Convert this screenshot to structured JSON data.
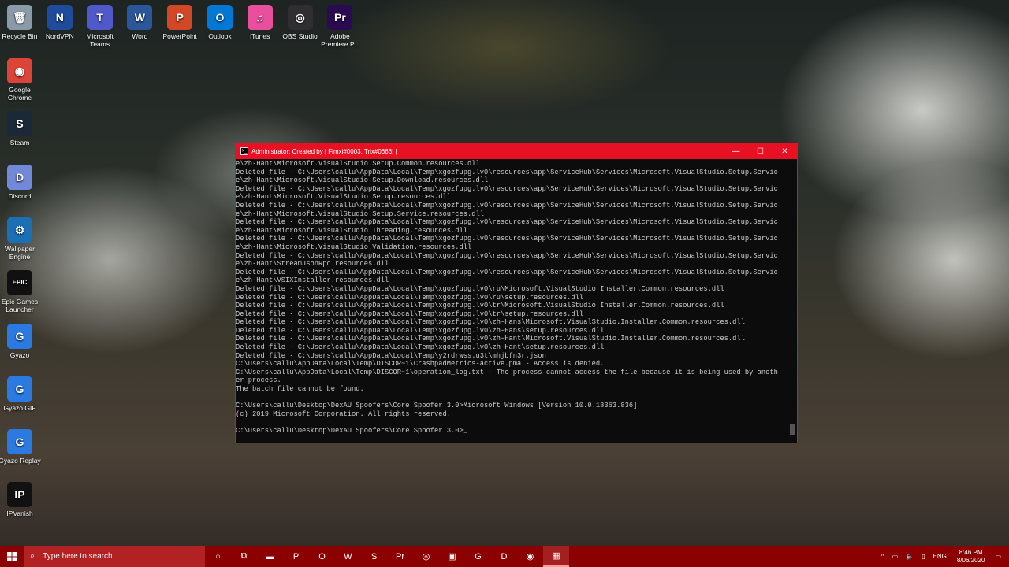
{
  "desktop": {
    "icons": [
      {
        "label": "Recycle Bin",
        "icon": "recycle-bin-icon",
        "color": "#8a9aa8",
        "glyph": "🗑"
      },
      {
        "label": "NordVPN",
        "icon": "nordvpn-icon",
        "color": "#1f4b9c",
        "glyph": "N"
      },
      {
        "label": "Microsoft\nTeams",
        "icon": "teams-icon",
        "color": "#5059c9",
        "glyph": "T"
      },
      {
        "label": "Word",
        "icon": "word-icon",
        "color": "#2b579a",
        "glyph": "W"
      },
      {
        "label": "PowerPoint",
        "icon": "powerpoint-icon",
        "color": "#d24726",
        "glyph": "P"
      },
      {
        "label": "Outlook",
        "icon": "outlook-icon",
        "color": "#0078d4",
        "glyph": "O"
      },
      {
        "label": "iTunes",
        "icon": "itunes-icon",
        "color": "#e94f9c",
        "glyph": "♫"
      },
      {
        "label": "OBS Studio",
        "icon": "obs-icon",
        "color": "#302e31",
        "glyph": "◎"
      },
      {
        "label": "Adobe\nPremiere P...",
        "icon": "premiere-icon",
        "color": "#2a0a50",
        "glyph": "Pr"
      },
      {
        "label": "Google\nChrome",
        "icon": "chrome-icon",
        "color": "#db4437",
        "glyph": "◉"
      },
      {
        "label": "Steam",
        "icon": "steam-icon",
        "color": "#1b2838",
        "glyph": "S"
      },
      {
        "label": "Discord",
        "icon": "discord-icon",
        "color": "#7289da",
        "glyph": "D"
      },
      {
        "label": "Wallpaper\nEngine",
        "icon": "wallpaper-engine-icon",
        "color": "#1a6fb5",
        "glyph": "⚙"
      },
      {
        "label": "Epic Games\nLauncher",
        "icon": "epic-games-icon",
        "color": "#111111",
        "glyph": "EPIC"
      },
      {
        "label": "Gyazo",
        "icon": "gyazo-icon",
        "color": "#2a7ae2",
        "glyph": "G"
      },
      {
        "label": "Gyazo GIF",
        "icon": "gyazo-gif-icon",
        "color": "#2a7ae2",
        "glyph": "G"
      },
      {
        "label": "Gyazo Replay",
        "icon": "gyazo-replay-icon",
        "color": "#2a7ae2",
        "glyph": "G"
      },
      {
        "label": "IPVanish",
        "icon": "ipvanish-icon",
        "color": "#111111",
        "glyph": "IP"
      }
    ]
  },
  "window": {
    "title": "Administrator: Created by | Fimxi#0003, Trix#0666! |",
    "minimize": "—",
    "maximize": "☐",
    "close": "✕",
    "accent": "#e81123",
    "console_lines": [
      "e\\zh-Hant\\Microsoft.VisualStudio.Setup.Common.resources.dll",
      "Deleted file - C:\\Users\\callu\\AppData\\Local\\Temp\\xgozfupg.lv0\\resources\\app\\ServiceHub\\Services\\Microsoft.VisualStudio.Setup.Servic",
      "e\\zh-Hant\\Microsoft.VisualStudio.Setup.Download.resources.dll",
      "Deleted file - C:\\Users\\callu\\AppData\\Local\\Temp\\xgozfupg.lv0\\resources\\app\\ServiceHub\\Services\\Microsoft.VisualStudio.Setup.Servic",
      "e\\zh-Hant\\Microsoft.VisualStudio.Setup.resources.dll",
      "Deleted file - C:\\Users\\callu\\AppData\\Local\\Temp\\xgozfupg.lv0\\resources\\app\\ServiceHub\\Services\\Microsoft.VisualStudio.Setup.Servic",
      "e\\zh-Hant\\Microsoft.VisualStudio.Setup.Service.resources.dll",
      "Deleted file - C:\\Users\\callu\\AppData\\Local\\Temp\\xgozfupg.lv0\\resources\\app\\ServiceHub\\Services\\Microsoft.VisualStudio.Setup.Servic",
      "e\\zh-Hant\\Microsoft.VisualStudio.Threading.resources.dll",
      "Deleted file - C:\\Users\\callu\\AppData\\Local\\Temp\\xgozfupg.lv0\\resources\\app\\ServiceHub\\Services\\Microsoft.VisualStudio.Setup.Servic",
      "e\\zh-Hant\\Microsoft.VisualStudio.Validation.resources.dll",
      "Deleted file - C:\\Users\\callu\\AppData\\Local\\Temp\\xgozfupg.lv0\\resources\\app\\ServiceHub\\Services\\Microsoft.VisualStudio.Setup.Servic",
      "e\\zh-Hant\\StreamJsonRpc.resources.dll",
      "Deleted file - C:\\Users\\callu\\AppData\\Local\\Temp\\xgozfupg.lv0\\resources\\app\\ServiceHub\\Services\\Microsoft.VisualStudio.Setup.Servic",
      "e\\zh-Hant\\VSIXInstaller.resources.dll",
      "Deleted file - C:\\Users\\callu\\AppData\\Local\\Temp\\xgozfupg.lv0\\ru\\Microsoft.VisualStudio.Installer.Common.resources.dll",
      "Deleted file - C:\\Users\\callu\\AppData\\Local\\Temp\\xgozfupg.lv0\\ru\\setup.resources.dll",
      "Deleted file - C:\\Users\\callu\\AppData\\Local\\Temp\\xgozfupg.lv0\\tr\\Microsoft.VisualStudio.Installer.Common.resources.dll",
      "Deleted file - C:\\Users\\callu\\AppData\\Local\\Temp\\xgozfupg.lv0\\tr\\setup.resources.dll",
      "Deleted file - C:\\Users\\callu\\AppData\\Local\\Temp\\xgozfupg.lv0\\zh-Hans\\Microsoft.VisualStudio.Installer.Common.resources.dll",
      "Deleted file - C:\\Users\\callu\\AppData\\Local\\Temp\\xgozfupg.lv0\\zh-Hans\\setup.resources.dll",
      "Deleted file - C:\\Users\\callu\\AppData\\Local\\Temp\\xgozfupg.lv0\\zh-Hant\\Microsoft.VisualStudio.Installer.Common.resources.dll",
      "Deleted file - C:\\Users\\callu\\AppData\\Local\\Temp\\xgozfupg.lv0\\zh-Hant\\setup.resources.dll",
      "Deleted file - C:\\Users\\callu\\AppData\\Local\\Temp\\y2rdrwss.u3t\\mhjbfn3r.json",
      "C:\\Users\\callu\\AppData\\Local\\Temp\\DISCOR~1\\CrashpadMetrics-active.pma - Access is denied.",
      "C:\\Users\\callu\\AppData\\Local\\Temp\\DISCOR~1\\operation_log.txt - The process cannot access the file because it is being used by anoth",
      "er process.",
      "The batch file cannot be found.",
      "",
      "C:\\Users\\callu\\Desktop\\DexAU Spoofers\\Core Spoofer 3.0>Microsoft Windows [Version 10.0.18363.836]",
      "(c) 2019 Microsoft Corporation. All rights reserved.",
      "",
      "C:\\Users\\callu\\Desktop\\DexAU Spoofers\\Core Spoofer 3.0>_"
    ]
  },
  "taskbar": {
    "color": "#8b0000",
    "search_placeholder": "Type here to search",
    "apps": [
      {
        "icon": "cortana-icon",
        "glyph": "○"
      },
      {
        "icon": "task-view-icon",
        "glyph": "⧉"
      },
      {
        "icon": "file-explorer-icon",
        "glyph": "▬"
      },
      {
        "icon": "powerpoint-icon",
        "glyph": "P"
      },
      {
        "icon": "outlook-icon",
        "glyph": "O"
      },
      {
        "icon": "word-icon",
        "glyph": "W"
      },
      {
        "icon": "steam-icon",
        "glyph": "S"
      },
      {
        "icon": "premiere-icon",
        "glyph": "Pr"
      },
      {
        "icon": "obs-icon",
        "glyph": "◎"
      },
      {
        "icon": "terminal-icon",
        "glyph": "▣"
      },
      {
        "icon": "gyazo-icon",
        "glyph": "G"
      },
      {
        "icon": "discord-icon",
        "glyph": "D"
      },
      {
        "icon": "chrome-icon",
        "glyph": "◉"
      },
      {
        "icon": "cmd-icon",
        "glyph": "▦",
        "active": true
      }
    ],
    "tray": {
      "chevron": "^",
      "network": "▭",
      "volume": "🔈",
      "battery": "▯",
      "language": "ENG",
      "time": "8:46 PM",
      "date": "8/06/2020",
      "notification": "▭"
    }
  }
}
